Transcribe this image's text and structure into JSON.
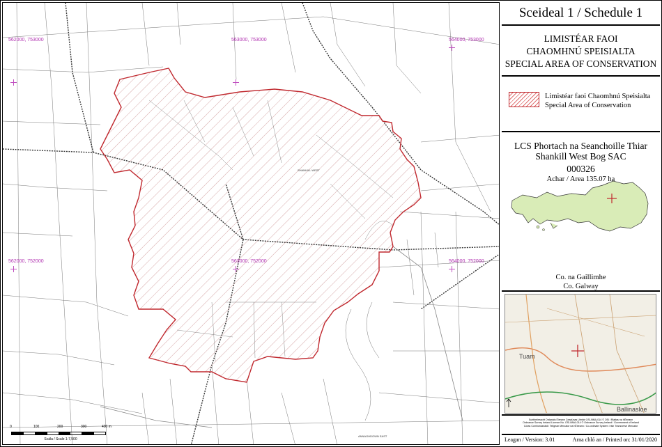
{
  "title": "Sceideal 1 / Schedule 1",
  "sac_header": {
    "line1": "LIMISTÉAR FAOI",
    "line2": "CHAOMHNÚ SPEISIALTA",
    "line3": "SPECIAL AREA OF CONSERVATION"
  },
  "legend": {
    "label_ga": "Limistéar faoi Chaomhnú Speisialta",
    "label_en": "Special Area of Conservation",
    "color": "#c0282e"
  },
  "site": {
    "name_ga": "LCS Phortach na Seanchoille Thiar",
    "name_en": "Shankill West Bog SAC",
    "code": "000326",
    "area": "Achar / Area 135.07 ha",
    "county_ga": "Co. na Gaillimhe",
    "county_en": "Co. Galway",
    "county_fill": "#d9ecb7"
  },
  "grid_labels": [
    "562000, 753000",
    "563000, 753000",
    "564000, 753000",
    "562000, 752000",
    "563000, 752000",
    "564000, 752000"
  ],
  "map_labels": {
    "shankill": "SHANKILL WEST",
    "road_label": "ANNAGHDOWN EAST"
  },
  "scale": {
    "ticks": [
      "0",
      "100",
      "200",
      "300",
      "400 m"
    ],
    "caption": "Scála / Scale 1:7,500"
  },
  "location_map": {
    "towns": [
      "Tuam",
      "Ballinasloe"
    ]
  },
  "credits": {
    "line1": "Suirbhéireacht Ordanáis Éireann Ceadúnas Uimhir OSI-NMA-014 © OSi / Rialtas na hÉireann",
    "line2": "Ordnance Survey Ireland Licence No. OSI-NMA-014 © Ordnance Survey Ireland / Government of Ireland",
    "line3": "Córas Comhordanáidí: Teilgean Mercator na hÉireann / Co-ordinate System: Irish Transverse Mercator"
  },
  "version": {
    "version": "Leagan / Version: 3.01",
    "printed": "Arna chló an / Printed on: 31/01/2020"
  }
}
